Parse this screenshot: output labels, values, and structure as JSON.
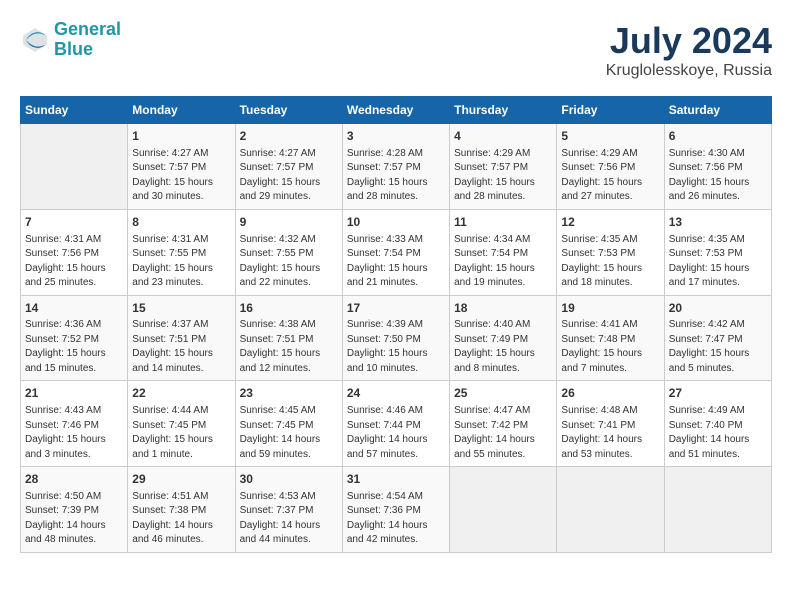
{
  "header": {
    "logo_line1": "General",
    "logo_line2": "Blue",
    "month_year": "July 2024",
    "location": "Kruglolesskoye, Russia"
  },
  "days_of_week": [
    "Sunday",
    "Monday",
    "Tuesday",
    "Wednesday",
    "Thursday",
    "Friday",
    "Saturday"
  ],
  "weeks": [
    [
      {
        "day": "",
        "info": ""
      },
      {
        "day": "1",
        "info": "Sunrise: 4:27 AM\nSunset: 7:57 PM\nDaylight: 15 hours\nand 30 minutes."
      },
      {
        "day": "2",
        "info": "Sunrise: 4:27 AM\nSunset: 7:57 PM\nDaylight: 15 hours\nand 29 minutes."
      },
      {
        "day": "3",
        "info": "Sunrise: 4:28 AM\nSunset: 7:57 PM\nDaylight: 15 hours\nand 28 minutes."
      },
      {
        "day": "4",
        "info": "Sunrise: 4:29 AM\nSunset: 7:57 PM\nDaylight: 15 hours\nand 28 minutes."
      },
      {
        "day": "5",
        "info": "Sunrise: 4:29 AM\nSunset: 7:56 PM\nDaylight: 15 hours\nand 27 minutes."
      },
      {
        "day": "6",
        "info": "Sunrise: 4:30 AM\nSunset: 7:56 PM\nDaylight: 15 hours\nand 26 minutes."
      }
    ],
    [
      {
        "day": "7",
        "info": "Sunrise: 4:31 AM\nSunset: 7:56 PM\nDaylight: 15 hours\nand 25 minutes."
      },
      {
        "day": "8",
        "info": "Sunrise: 4:31 AM\nSunset: 7:55 PM\nDaylight: 15 hours\nand 23 minutes."
      },
      {
        "day": "9",
        "info": "Sunrise: 4:32 AM\nSunset: 7:55 PM\nDaylight: 15 hours\nand 22 minutes."
      },
      {
        "day": "10",
        "info": "Sunrise: 4:33 AM\nSunset: 7:54 PM\nDaylight: 15 hours\nand 21 minutes."
      },
      {
        "day": "11",
        "info": "Sunrise: 4:34 AM\nSunset: 7:54 PM\nDaylight: 15 hours\nand 19 minutes."
      },
      {
        "day": "12",
        "info": "Sunrise: 4:35 AM\nSunset: 7:53 PM\nDaylight: 15 hours\nand 18 minutes."
      },
      {
        "day": "13",
        "info": "Sunrise: 4:35 AM\nSunset: 7:53 PM\nDaylight: 15 hours\nand 17 minutes."
      }
    ],
    [
      {
        "day": "14",
        "info": "Sunrise: 4:36 AM\nSunset: 7:52 PM\nDaylight: 15 hours\nand 15 minutes."
      },
      {
        "day": "15",
        "info": "Sunrise: 4:37 AM\nSunset: 7:51 PM\nDaylight: 15 hours\nand 14 minutes."
      },
      {
        "day": "16",
        "info": "Sunrise: 4:38 AM\nSunset: 7:51 PM\nDaylight: 15 hours\nand 12 minutes."
      },
      {
        "day": "17",
        "info": "Sunrise: 4:39 AM\nSunset: 7:50 PM\nDaylight: 15 hours\nand 10 minutes."
      },
      {
        "day": "18",
        "info": "Sunrise: 4:40 AM\nSunset: 7:49 PM\nDaylight: 15 hours\nand 8 minutes."
      },
      {
        "day": "19",
        "info": "Sunrise: 4:41 AM\nSunset: 7:48 PM\nDaylight: 15 hours\nand 7 minutes."
      },
      {
        "day": "20",
        "info": "Sunrise: 4:42 AM\nSunset: 7:47 PM\nDaylight: 15 hours\nand 5 minutes."
      }
    ],
    [
      {
        "day": "21",
        "info": "Sunrise: 4:43 AM\nSunset: 7:46 PM\nDaylight: 15 hours\nand 3 minutes."
      },
      {
        "day": "22",
        "info": "Sunrise: 4:44 AM\nSunset: 7:45 PM\nDaylight: 15 hours\nand 1 minute."
      },
      {
        "day": "23",
        "info": "Sunrise: 4:45 AM\nSunset: 7:45 PM\nDaylight: 14 hours\nand 59 minutes."
      },
      {
        "day": "24",
        "info": "Sunrise: 4:46 AM\nSunset: 7:44 PM\nDaylight: 14 hours\nand 57 minutes."
      },
      {
        "day": "25",
        "info": "Sunrise: 4:47 AM\nSunset: 7:42 PM\nDaylight: 14 hours\nand 55 minutes."
      },
      {
        "day": "26",
        "info": "Sunrise: 4:48 AM\nSunset: 7:41 PM\nDaylight: 14 hours\nand 53 minutes."
      },
      {
        "day": "27",
        "info": "Sunrise: 4:49 AM\nSunset: 7:40 PM\nDaylight: 14 hours\nand 51 minutes."
      }
    ],
    [
      {
        "day": "28",
        "info": "Sunrise: 4:50 AM\nSunset: 7:39 PM\nDaylight: 14 hours\nand 48 minutes."
      },
      {
        "day": "29",
        "info": "Sunrise: 4:51 AM\nSunset: 7:38 PM\nDaylight: 14 hours\nand 46 minutes."
      },
      {
        "day": "30",
        "info": "Sunrise: 4:53 AM\nSunset: 7:37 PM\nDaylight: 14 hours\nand 44 minutes."
      },
      {
        "day": "31",
        "info": "Sunrise: 4:54 AM\nSunset: 7:36 PM\nDaylight: 14 hours\nand 42 minutes."
      },
      {
        "day": "",
        "info": ""
      },
      {
        "day": "",
        "info": ""
      },
      {
        "day": "",
        "info": ""
      }
    ]
  ]
}
